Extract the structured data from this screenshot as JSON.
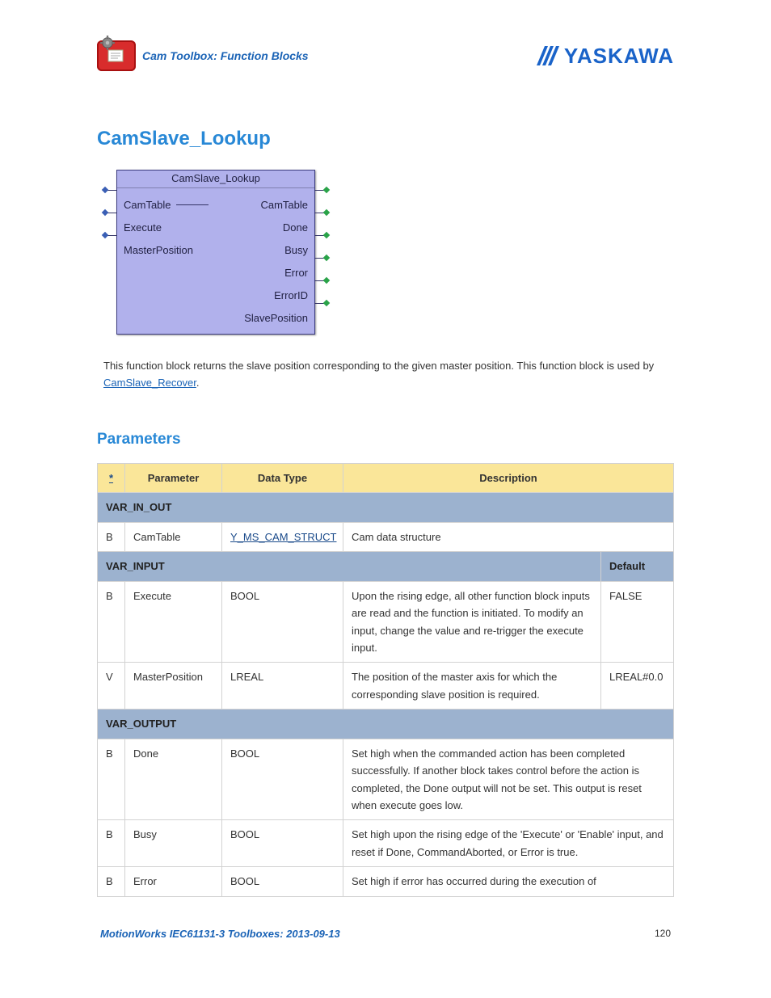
{
  "header": {
    "breadcrumb": "Cam Toolbox: Function Blocks",
    "brand": "YASKAWA"
  },
  "title": "CamSlave_Lookup",
  "function_block": {
    "title": "CamSlave_Lookup",
    "rows": [
      {
        "left": "CamTable",
        "right": "CamTable",
        "inout": true
      },
      {
        "left": "Execute",
        "right": "Done"
      },
      {
        "left": "MasterPosition",
        "right": "Busy"
      },
      {
        "left": "",
        "right": "Error"
      },
      {
        "left": "",
        "right": "ErrorID"
      },
      {
        "left": "",
        "right": "SlavePosition"
      }
    ]
  },
  "description": {
    "text_a": "This function block returns the slave position corresponding to the given master position.  This function block is used by ",
    "link": "CamSlave_Recover",
    "text_b": "."
  },
  "parameters_heading": "Parameters",
  "table": {
    "head": [
      "*",
      "Parameter",
      "Data Type",
      "Description"
    ],
    "default_label": "Default",
    "sections": {
      "var_in_out": "VAR_IN_OUT",
      "var_input": "VAR_INPUT",
      "var_output": "VAR_OUTPUT"
    },
    "var_in_out_rows": [
      {
        "star": "B",
        "param": "CamTable",
        "type": "Y_MS_CAM_STRUCT",
        "type_link": true,
        "desc": "Cam data structure"
      }
    ],
    "var_input_rows": [
      {
        "star": "B",
        "param": "Execute",
        "type": "BOOL",
        "desc": "Upon the rising edge, all other function block inputs are read and the function is initiated. To modify an input, change the value and re-trigger the execute input.",
        "default": "FALSE"
      },
      {
        "star": "V",
        "param": "MasterPosition",
        "type": "LREAL",
        "desc": "The position of the master axis for which the corresponding slave position is required.",
        "default": "LREAL#0.0"
      }
    ],
    "var_output_rows": [
      {
        "star": "B",
        "param": "Done",
        "type": "BOOL",
        "desc": "Set high when the commanded action has been completed successfully. If another block takes control before the action is completed, the Done output will not be set. This output is reset when execute goes low."
      },
      {
        "star": "B",
        "param": "Busy",
        "type": "BOOL",
        "desc": "Set high upon the rising edge of the 'Execute' or 'Enable' input, and reset if Done, CommandAborted, or Error is true."
      },
      {
        "star": "B",
        "param": "Error",
        "type": "BOOL",
        "desc": "Set high if error has occurred during the execution of"
      }
    ]
  },
  "footer": {
    "title": "MotionWorks IEC61131-3 Toolboxes: 2013-09-13",
    "page": "120"
  }
}
